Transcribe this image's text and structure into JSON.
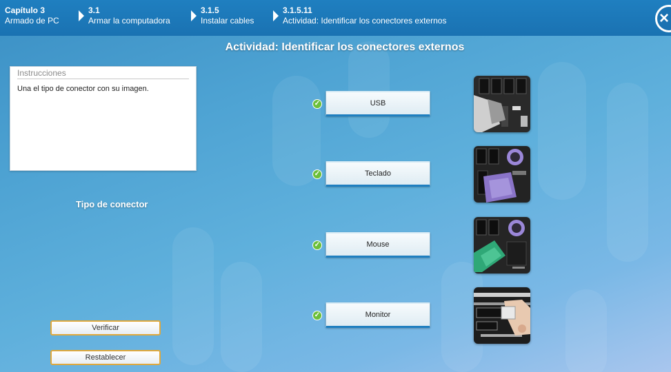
{
  "breadcrumb": [
    {
      "num": "Capítulo 3",
      "label": "Armado de PC"
    },
    {
      "num": "3.1",
      "label": "Armar la computadora"
    },
    {
      "num": "3.1.5",
      "label": "Instalar cables"
    },
    {
      "num": "3.1.5.11",
      "label": "Actividad: Identificar los conectores externos"
    }
  ],
  "activity_title": "Actividad: Identificar los conectores externos",
  "instructions": {
    "heading": "Instrucciones",
    "text": "Una el tipo de conector con su imagen."
  },
  "connector_type_label": "Tipo de conector",
  "buttons": {
    "verify": "Verificar",
    "reset": "Restablecer"
  },
  "connectors": [
    {
      "label": "USB",
      "correct": true,
      "image_icon": "usb-connector-photo"
    },
    {
      "label": "Teclado",
      "correct": true,
      "image_icon": "ps2-keyboard-connector-photo"
    },
    {
      "label": "Mouse",
      "correct": true,
      "image_icon": "ps2-mouse-connector-photo"
    },
    {
      "label": "Monitor",
      "correct": true,
      "image_icon": "vga-monitor-connector-photo"
    }
  ],
  "colors": {
    "header_bg": "#1a72b2",
    "check_green": "#6cbf3a",
    "button_border_orange": "#e0a83a",
    "keyboard_purple": "#8a74c8",
    "mouse_green": "#2fa877"
  }
}
